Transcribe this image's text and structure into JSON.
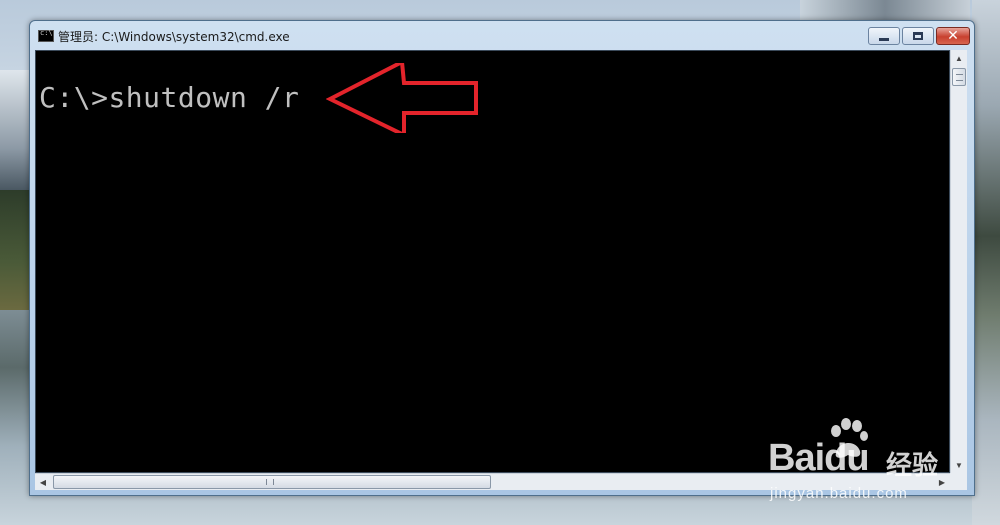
{
  "window": {
    "title": "管理员: C:\\Windows\\system32\\cmd.exe",
    "minimize_icon": "minimize-icon",
    "maximize_icon": "maximize-icon",
    "close_icon": "close-icon",
    "close_glyph": "✕"
  },
  "console": {
    "prompt": "C:\\>",
    "command": "shutdown /r",
    "annotation": "red-arrow-pointing-left",
    "annotation_color": "#e3242b"
  },
  "scrollbars": {
    "up_glyph": "▲",
    "down_glyph": "▼",
    "left_glyph": "◀",
    "right_glyph": "▶"
  },
  "watermark": {
    "logo": "Baidu",
    "suffix": "经验",
    "url": "jingyan.baidu.com"
  }
}
